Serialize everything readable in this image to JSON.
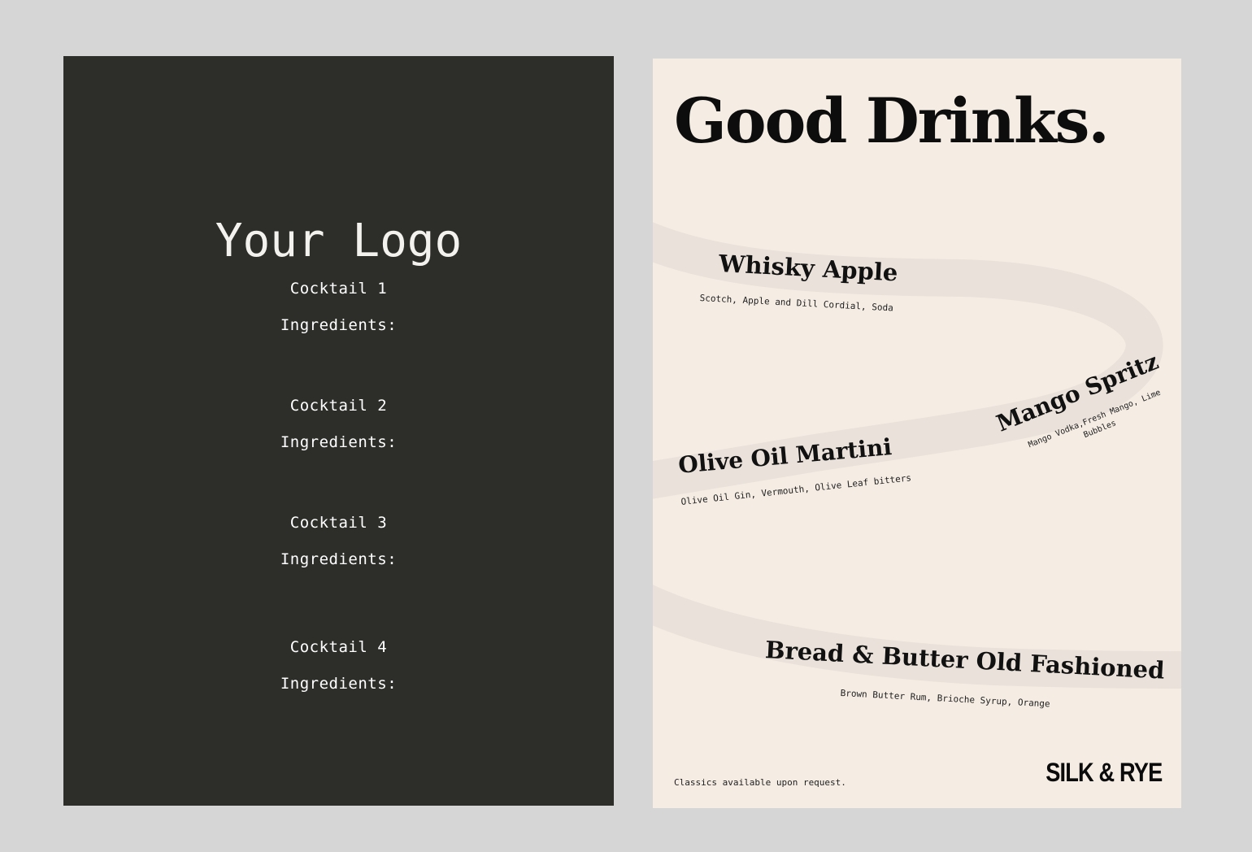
{
  "left_card": {
    "logo_text": "Your Logo",
    "cocktails": [
      {
        "name": "Cocktail 1",
        "ingredients_label": "Ingredients:"
      },
      {
        "name": "Cocktail 2",
        "ingredients_label": "Ingredients:"
      },
      {
        "name": "Cocktail 3",
        "ingredients_label": "Ingredients:"
      },
      {
        "name": "Cocktail 4",
        "ingredients_label": "Ingredients:"
      }
    ]
  },
  "right_card": {
    "headline": "Good Drinks.",
    "drinks": [
      {
        "name": "Whisky Apple",
        "ingredients": "Scotch, Apple and Dill Cordial, Soda"
      },
      {
        "name": "Mango Spritz",
        "ingredients_line1": "Mango Vodka,Fresh Mango, Lime",
        "ingredients_line2": "Bubbles"
      },
      {
        "name": "Olive Oil Martini",
        "ingredients": "Olive Oil Gin, Vermouth, Olive Leaf bitters"
      },
      {
        "name": "Bread & Butter Old Fashioned",
        "ingredients": "Brown Butter Rum, Brioche Syrup, Orange"
      }
    ],
    "footer_note": "Classics available upon request.",
    "brand": "SILK & RYE"
  },
  "colors": {
    "page_background": "#d6d6d6",
    "left_card_background": "#2d2d29",
    "right_card_background": "#f5ede4",
    "ribbon": "#eae2da"
  }
}
